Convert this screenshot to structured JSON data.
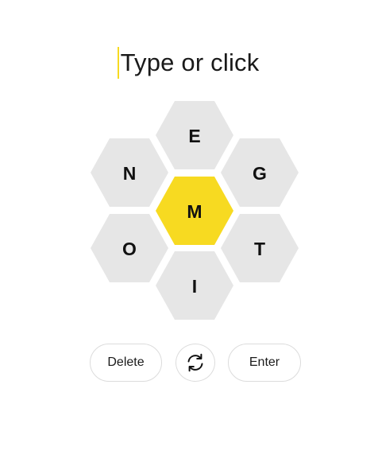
{
  "input": {
    "placeholder": "Type or click"
  },
  "hive": {
    "center_letter": "M",
    "outer_letters": {
      "top": "E",
      "upper_left": "N",
      "upper_right": "G",
      "lower_left": "O",
      "lower_right": "T",
      "bottom": "I"
    }
  },
  "controls": {
    "delete_label": "Delete",
    "shuffle_icon": "shuffle-icon",
    "enter_label": "Enter"
  },
  "colors": {
    "center_cell": "#f7da21",
    "outer_cell": "#e6e6e6",
    "caret": "#f7da21"
  }
}
